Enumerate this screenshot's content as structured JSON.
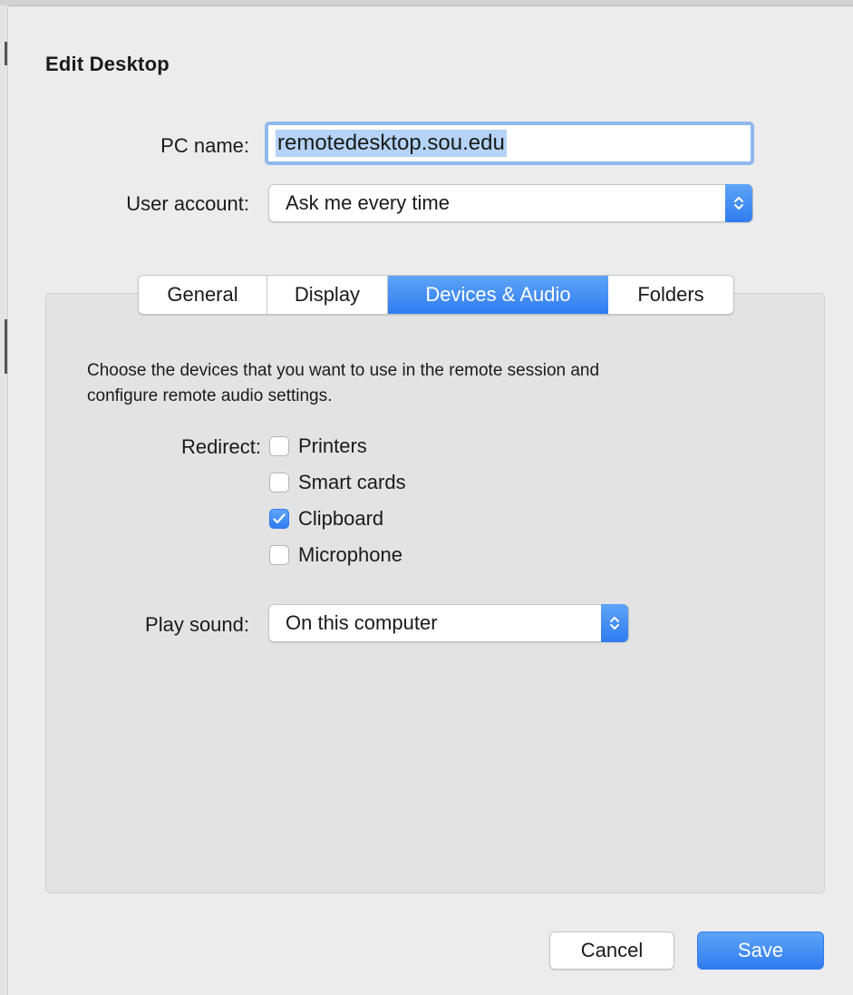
{
  "dialog": {
    "title": "Edit Desktop"
  },
  "pc_name": {
    "label": "PC name:",
    "value": "remotedesktop.sou.edu"
  },
  "user_account": {
    "label": "User account:",
    "selected": "Ask me every time"
  },
  "tabs": [
    {
      "label": "General",
      "active": false
    },
    {
      "label": "Display",
      "active": false
    },
    {
      "label": "Devices & Audio",
      "active": true
    },
    {
      "label": "Folders",
      "active": false
    }
  ],
  "devices": {
    "description_line1": "Choose the devices that you want to use in the remote session and",
    "description_line2": "configure remote audio settings.",
    "redirect_label": "Redirect:",
    "options": [
      {
        "label": "Printers",
        "checked": false
      },
      {
        "label": "Smart cards",
        "checked": false
      },
      {
        "label": "Clipboard",
        "checked": true
      },
      {
        "label": "Microphone",
        "checked": false
      }
    ],
    "play_sound_label": "Play sound:",
    "play_sound_selected": "On this computer"
  },
  "buttons": {
    "cancel": "Cancel",
    "save": "Save"
  },
  "colors": {
    "accent": "#2f7cf0",
    "selection": "#b4d3f7",
    "panel": "#e3e3e3"
  }
}
